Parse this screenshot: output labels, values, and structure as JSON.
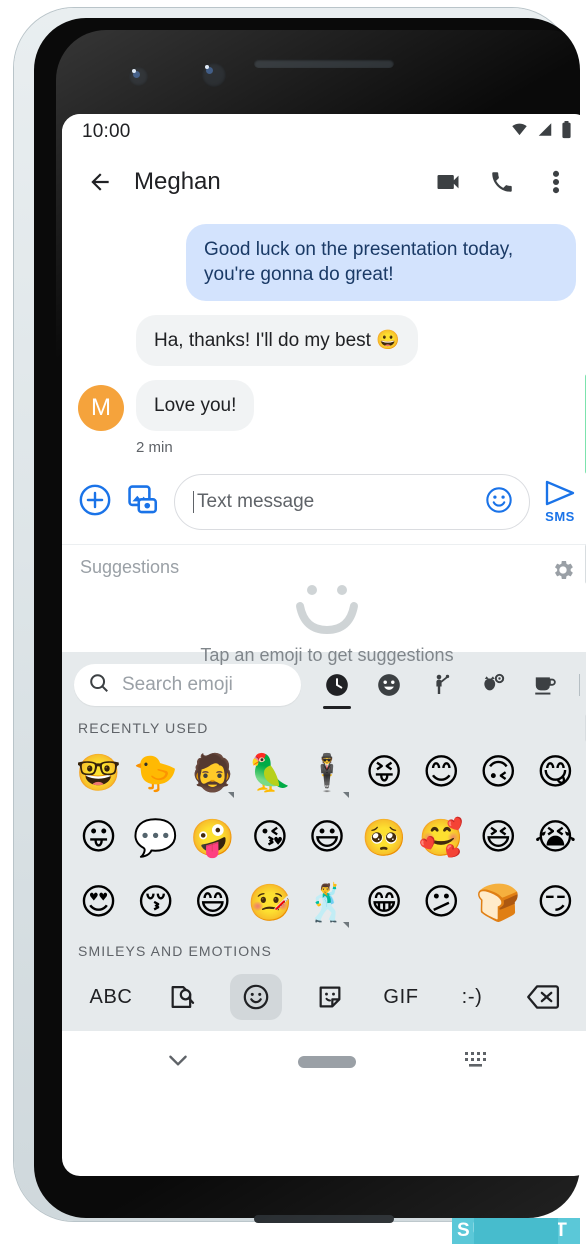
{
  "status_bar": {
    "time": "10:00",
    "icons": [
      "wifi-icon",
      "cellular-signal-icon",
      "battery-icon"
    ]
  },
  "app_bar": {
    "back_icon": "back-arrow-icon",
    "title": "Meghan",
    "actions": [
      "video-call-icon",
      "phone-call-icon",
      "overflow-menu-icon"
    ]
  },
  "conversation": {
    "messages": [
      {
        "direction": "outgoing",
        "text": "Good luck on the presentation today, you're gonna do great!"
      },
      {
        "direction": "incoming",
        "text": "Ha, thanks! I'll do my best 😀"
      },
      {
        "direction": "incoming",
        "text": "Love you!",
        "avatar_letter": "M"
      }
    ],
    "timestamp": "2 min",
    "avatar_color": "#f5a33c",
    "outgoing_bubble_color": "#d3e3fd",
    "incoming_bubble_color": "#f1f3f4"
  },
  "compose": {
    "add_icon": "plus-circle-icon",
    "gallery_icon": "gallery-image-icon",
    "placeholder": "Text message",
    "emoji_icon": "emoji-smiley-icon",
    "send_icon": "send-arrow-icon",
    "send_label": "SMS",
    "accent_color": "#1a73e8"
  },
  "suggestions": {
    "header": "Suggestions",
    "settings_icon": "gear-icon",
    "empty_icon": "smiley-outline-icon",
    "empty_text": "Tap an emoji to get suggestions"
  },
  "emoji_keyboard": {
    "search_placeholder": "Search emoji",
    "search_icon": "search-icon",
    "tabs": [
      {
        "name": "recently-used",
        "icon": "clock-icon",
        "active": true
      },
      {
        "name": "smileys-and-emotions",
        "icon": "smiley-icon",
        "active": false
      },
      {
        "name": "people",
        "icon": "person-waving-icon",
        "active": false
      },
      {
        "name": "animals-and-nature",
        "icon": "animals-nature-icon",
        "active": false
      },
      {
        "name": "food-and-drink",
        "icon": "coffee-cup-icon",
        "active": false
      }
    ],
    "section_recent_label": "RECENTLY USED",
    "section_next_label": "SMILEYS AND EMOTIONS",
    "recent_emojis": [
      {
        "glyph": "🤓",
        "name": "nerd-face",
        "variants": false
      },
      {
        "glyph": "🐤",
        "name": "baby-chick",
        "variants": false
      },
      {
        "glyph": "🧔",
        "name": "bearded-person",
        "variants": true
      },
      {
        "glyph": "🦜",
        "name": "parrot",
        "variants": false
      },
      {
        "glyph": "🕴",
        "name": "person-in-suit-levitating",
        "variants": true
      },
      {
        "glyph": "😝",
        "name": "squinting-face-with-tongue",
        "variants": false
      },
      {
        "glyph": "😊",
        "name": "smiling-face-with-smiling-eyes",
        "variants": false
      },
      {
        "glyph": "🙃",
        "name": "upside-down-face",
        "variants": false
      },
      {
        "glyph": "😋",
        "name": "face-savoring-food",
        "variants": false
      },
      {
        "glyph": "😛",
        "name": "face-with-tongue",
        "variants": false
      },
      {
        "glyph": "💬",
        "name": "speech-balloon",
        "variants": false
      },
      {
        "glyph": "🤪",
        "name": "zany-face",
        "variants": false
      },
      {
        "glyph": "😘",
        "name": "face-blowing-a-kiss",
        "variants": false
      },
      {
        "glyph": "😃",
        "name": "grinning-face-with-big-eyes",
        "variants": false
      },
      {
        "glyph": "🥺",
        "name": "pleading-face",
        "variants": false
      },
      {
        "glyph": "🥰",
        "name": "smiling-face-with-hearts",
        "variants": false
      },
      {
        "glyph": "😆",
        "name": "grinning-squinting-face",
        "variants": false
      },
      {
        "glyph": "😭",
        "name": "loudly-crying-face",
        "variants": false
      },
      {
        "glyph": "😍",
        "name": "smiling-face-with-heart-eyes",
        "variants": false
      },
      {
        "glyph": "😚",
        "name": "kissing-face-with-closed-eyes",
        "variants": false
      },
      {
        "glyph": "😄",
        "name": "grinning-face-with-smiling-eyes",
        "variants": false
      },
      {
        "glyph": "🤒",
        "name": "face-with-thermometer",
        "variants": false
      },
      {
        "glyph": "🕺",
        "name": "man-dancing",
        "variants": true
      },
      {
        "glyph": "😁",
        "name": "beaming-face-with-smiling-eyes",
        "variants": false
      },
      {
        "glyph": "😕",
        "name": "confused-face",
        "variants": false
      },
      {
        "glyph": "🍞",
        "name": "bread",
        "variants": false
      },
      {
        "glyph": "😏",
        "name": "smirking-face",
        "variants": false
      }
    ]
  },
  "keyboard_toolbar": {
    "items": [
      {
        "label": "ABC",
        "name": "abc-keyboard-button",
        "icon": null,
        "active": false
      },
      {
        "label": "",
        "name": "search-sticker-icon",
        "icon": "image-search-icon",
        "active": false
      },
      {
        "label": "",
        "name": "emoji-button",
        "icon": "smiley-outline-icon",
        "active": true
      },
      {
        "label": "",
        "name": "sticker-button",
        "icon": "sticker-icon",
        "active": false
      },
      {
        "label": "GIF",
        "name": "gif-button",
        "icon": null,
        "active": false
      },
      {
        "label": ":-)",
        "name": "emoticon-button",
        "icon": null,
        "active": false
      },
      {
        "label": "",
        "name": "backspace-button",
        "icon": "backspace-icon",
        "active": false
      }
    ]
  },
  "nav_bar": {
    "back_icon": "chevron-down-icon",
    "home_icon": "home-pill-icon",
    "keyboard_switch_icon": "keyboard-switcher-icon"
  },
  "watermark": {
    "text": "SUPPORT"
  }
}
